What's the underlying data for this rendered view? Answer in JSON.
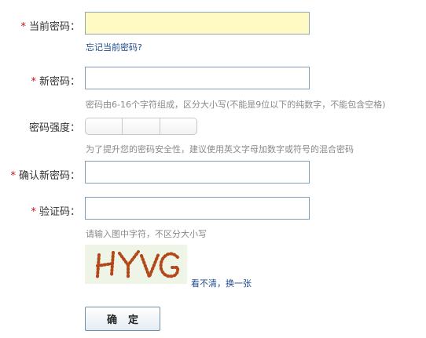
{
  "form": {
    "required_mark": "*",
    "current_password": {
      "label": "当前密码：",
      "value": ""
    },
    "forgot_link": "忘记当前密码?",
    "new_password": {
      "label": "新密码：",
      "value": "",
      "hint": "密码由6-16个字符组成，区分大小写(不能是9位以下的纯数字，不能包含空格)"
    },
    "strength": {
      "label": "密码强度：",
      "hint": "为了提升您的密码安全性，建议使用英文字母加数字或符号的混合密码"
    },
    "confirm_password": {
      "label": "确认新密码：",
      "value": ""
    },
    "captcha": {
      "label": "验证码：",
      "value": "",
      "hint": "请输入图中字符，不区分大小写",
      "image_text": "HYVG",
      "refresh_link": "看不清，换一张"
    },
    "submit_label": "确定"
  },
  "colors": {
    "required": "#c81010",
    "active_field_bg": "#fff9c4",
    "link": "#1d4a8c",
    "hint": "#8a8a8a",
    "captcha_text": "#b3471a",
    "captcha_bg": "#eef5e7"
  }
}
